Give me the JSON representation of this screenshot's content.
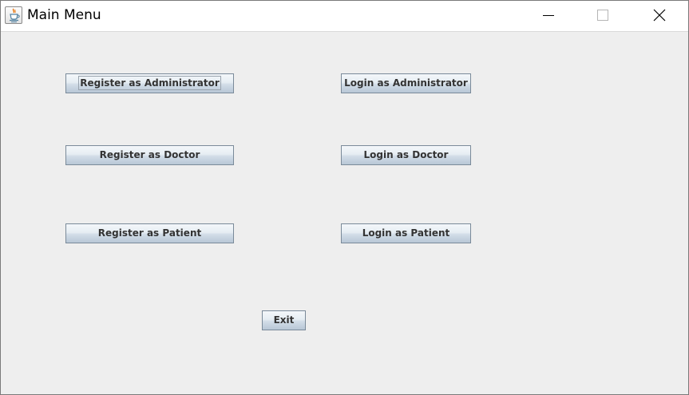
{
  "window": {
    "title": "Main Menu",
    "app_icon": "java-cup-icon"
  },
  "controls": {
    "minimize_icon": "minimize-icon",
    "maximize_icon": "maximize-icon",
    "close_icon": "close-icon"
  },
  "buttons": {
    "register_admin": "Register as Administrator",
    "login_admin": "Login as Administrator",
    "register_doctor": "Register as Doctor",
    "login_doctor": "Login as Doctor",
    "register_patient": "Register as Patient",
    "login_patient": "Login as Patient",
    "exit": "Exit"
  },
  "focused_button": "register_admin",
  "colors": {
    "window_bg": "#eeeeee",
    "titlebar_bg": "#ffffff",
    "button_text": "#333333",
    "button_border": "#7a8a99"
  }
}
